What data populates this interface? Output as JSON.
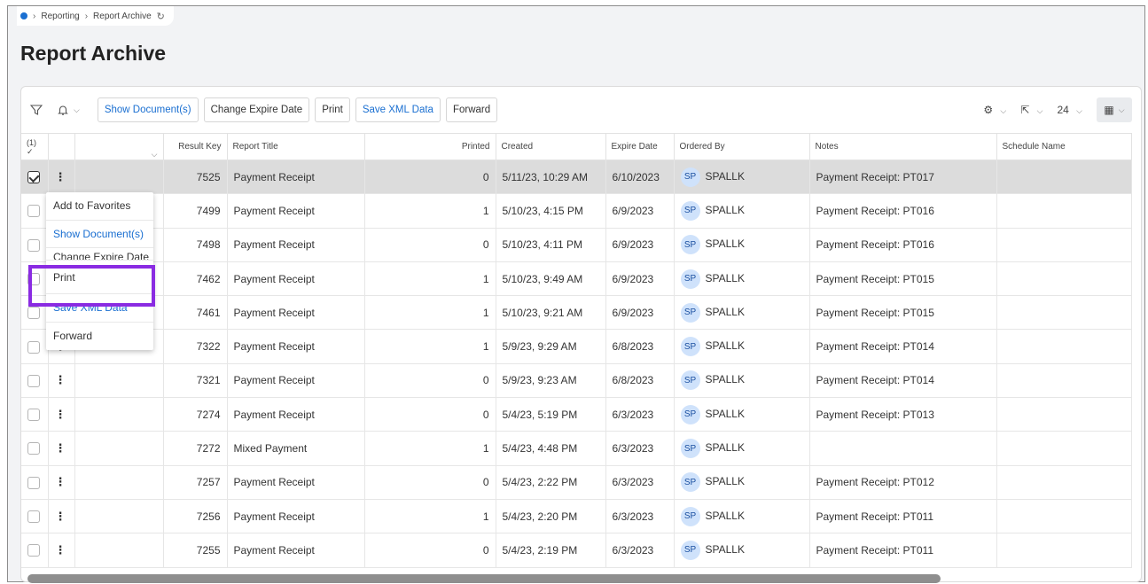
{
  "breadcrumb": {
    "items": [
      "Reporting",
      "Report Archive"
    ]
  },
  "page": {
    "title": "Report Archive"
  },
  "toolbar": {
    "show_documents": "Show Document(s)",
    "change_expire": "Change Expire Date",
    "print": "Print",
    "save_xml": "Save XML Data",
    "forward": "Forward",
    "page_size": "24"
  },
  "table": {
    "select_count": "(1)",
    "columns": [
      "Result Key",
      "Report Title",
      "Printed",
      "Created",
      "Expire Date",
      "Ordered By",
      "Notes",
      "Schedule Name"
    ],
    "rows": [
      {
        "key": "7525",
        "title": "Payment Receipt",
        "printed": "0",
        "created": "5/11/23, 10:29 AM",
        "expire": "6/10/2023",
        "initials": "SP",
        "user": "SPALLK",
        "notes": "Payment Receipt: PT017",
        "schedule": ""
      },
      {
        "key": "7499",
        "title": "Payment Receipt",
        "printed": "1",
        "created": "5/10/23, 4:15 PM",
        "expire": "6/9/2023",
        "initials": "SP",
        "user": "SPALLK",
        "notes": "Payment Receipt: PT016",
        "schedule": ""
      },
      {
        "key": "7498",
        "title": "Payment Receipt",
        "printed": "0",
        "created": "5/10/23, 4:11 PM",
        "expire": "6/9/2023",
        "initials": "SP",
        "user": "SPALLK",
        "notes": "Payment Receipt: PT016",
        "schedule": ""
      },
      {
        "key": "7462",
        "title": "Payment Receipt",
        "printed": "1",
        "created": "5/10/23, 9:49 AM",
        "expire": "6/9/2023",
        "initials": "SP",
        "user": "SPALLK",
        "notes": "Payment Receipt: PT015",
        "schedule": ""
      },
      {
        "key": "7461",
        "title": "Payment Receipt",
        "printed": "1",
        "created": "5/10/23, 9:21 AM",
        "expire": "6/9/2023",
        "initials": "SP",
        "user": "SPALLK",
        "notes": "Payment Receipt: PT015",
        "schedule": ""
      },
      {
        "key": "7322",
        "title": "Payment Receipt",
        "printed": "1",
        "created": "5/9/23, 9:29 AM",
        "expire": "6/8/2023",
        "initials": "SP",
        "user": "SPALLK",
        "notes": "Payment Receipt: PT014",
        "schedule": ""
      },
      {
        "key": "7321",
        "title": "Payment Receipt",
        "printed": "0",
        "created": "5/9/23, 9:23 AM",
        "expire": "6/8/2023",
        "initials": "SP",
        "user": "SPALLK",
        "notes": "Payment Receipt: PT014",
        "schedule": ""
      },
      {
        "key": "7274",
        "title": "Payment Receipt",
        "printed": "0",
        "created": "5/4/23, 5:19 PM",
        "expire": "6/3/2023",
        "initials": "SP",
        "user": "SPALLK",
        "notes": "Payment Receipt: PT013",
        "schedule": ""
      },
      {
        "key": "7272",
        "title": "Mixed Payment",
        "printed": "1",
        "created": "5/4/23, 4:48 PM",
        "expire": "6/3/2023",
        "initials": "SP",
        "user": "SPALLK",
        "notes": "",
        "schedule": ""
      },
      {
        "key": "7257",
        "title": "Payment Receipt",
        "printed": "0",
        "created": "5/4/23, 2:22 PM",
        "expire": "6/3/2023",
        "initials": "SP",
        "user": "SPALLK",
        "notes": "Payment Receipt: PT012",
        "schedule": ""
      },
      {
        "key": "7256",
        "title": "Payment Receipt",
        "printed": "1",
        "created": "5/4/23, 2:20 PM",
        "expire": "6/3/2023",
        "initials": "SP",
        "user": "SPALLK",
        "notes": "Payment Receipt: PT011",
        "schedule": ""
      },
      {
        "key": "7255",
        "title": "Payment Receipt",
        "printed": "0",
        "created": "5/4/23, 2:19 PM",
        "expire": "6/3/2023",
        "initials": "SP",
        "user": "SPALLK",
        "notes": "Payment Receipt: PT011",
        "schedule": ""
      }
    ]
  },
  "context_menu": {
    "add_favorites": "Add to Favorites",
    "show_documents": "Show Document(s)",
    "change_expire": "Change Expire Date",
    "print": "Print",
    "save_xml": "Save XML Data",
    "forward": "Forward"
  },
  "colors": {
    "accent": "#1a6fd1",
    "highlight": "#8a2be2",
    "selected_row": "#dcdcdc"
  }
}
